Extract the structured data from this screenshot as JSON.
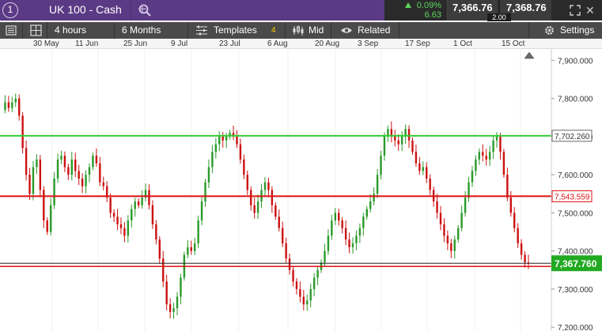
{
  "header": {
    "instrument": "UK 100 - Cash",
    "info_glyph": "1",
    "change_pct": "0.09%",
    "change_points": "6.63",
    "sell_price": "7,366.76",
    "buy_price": "7,368.76",
    "spread": "2.00"
  },
  "toolbar": {
    "interval": "4 hours",
    "range": "6 Months",
    "templates": "Templates",
    "templates_count": "4",
    "price_type": "Mid",
    "related": "Related",
    "settings": "Settings"
  },
  "icons": {
    "info": "info-icon",
    "search": "search-icon",
    "add_tab": "plus-icon",
    "expand": "expand-icon",
    "close": "close-icon",
    "menu": "menu-icon",
    "layout": "layout-grid-icon",
    "templates": "sliders-icon",
    "price_type": "candles-icon",
    "related": "eye-icon",
    "settings": "gear-icon",
    "scroll": "scroll-end-icon"
  },
  "colors": {
    "header_bg": "#5b3a85",
    "up": "#2a9a2a",
    "down": "#cc1111",
    "line_green": "#33cc33",
    "line_red": "#dd1111",
    "price_tag_green": "#22aa22"
  },
  "chart_data": {
    "type": "line",
    "x_ticks": [
      "30 May",
      "11 Jun",
      "25 Jun",
      "9 Jul",
      "23 Jul",
      "6 Aug",
      "20 Aug",
      "3 Sep",
      "17 Sep",
      "1 Oct",
      "15 Oct"
    ],
    "y_ticks": [
      "7,900.000",
      "7,800.000",
      "7,700.000",
      "7,600.000",
      "7,500.000",
      "7,400.000",
      "7,300.000",
      "7,200.000"
    ],
    "ylim": [
      7190,
      7930
    ],
    "horizontal_lines": [
      {
        "label": "7,702.260",
        "value": 7702.26,
        "color": "#33cc33"
      },
      {
        "label": "7,543.559",
        "value": 7543.559,
        "color": "#dd1111"
      }
    ],
    "current_price": {
      "label": "7,367.760",
      "value": 7367.76
    },
    "series": [
      {
        "values": [
          7770,
          7790,
          7775,
          7790,
          7800,
          7755,
          7670,
          7600,
          7550,
          7620,
          7640,
          7560,
          7480,
          7450,
          7520,
          7590,
          7640,
          7650,
          7620,
          7600,
          7640,
          7610,
          7590,
          7570,
          7600,
          7620,
          7650,
          7630,
          7580,
          7570,
          7540,
          7500,
          7490,
          7470,
          7460,
          7440,
          7480,
          7510,
          7530,
          7520,
          7540,
          7560,
          7520,
          7470,
          7430,
          7380,
          7320,
          7260,
          7240,
          7250,
          7280,
          7330,
          7390,
          7410,
          7400,
          7420,
          7480,
          7530,
          7580,
          7620,
          7660,
          7680,
          7700,
          7690,
          7700,
          7710,
          7700,
          7680,
          7640,
          7600,
          7560,
          7520,
          7500,
          7530,
          7560,
          7580,
          7560,
          7520,
          7490,
          7460,
          7420,
          7380,
          7350,
          7320,
          7300,
          7280,
          7260,
          7270,
          7300,
          7330,
          7350,
          7370,
          7400,
          7440,
          7480,
          7500,
          7480,
          7460,
          7430,
          7410,
          7420,
          7440,
          7460,
          7490,
          7510,
          7530,
          7550,
          7600,
          7650,
          7700,
          7720,
          7700,
          7690,
          7680,
          7700,
          7720,
          7690,
          7660,
          7630,
          7610,
          7620,
          7590,
          7560,
          7530,
          7500,
          7470,
          7440,
          7420,
          7400,
          7430,
          7460,
          7500,
          7540,
          7580,
          7610,
          7640,
          7660,
          7650,
          7640,
          7660,
          7690,
          7700,
          7660,
          7600,
          7540,
          7500,
          7460,
          7420,
          7390,
          7370,
          7367.76
        ]
      }
    ]
  }
}
